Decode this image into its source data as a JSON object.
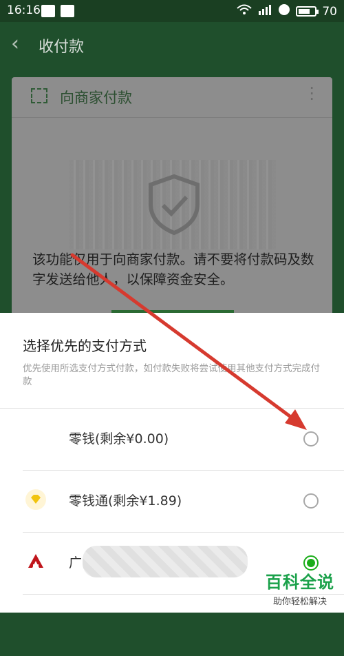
{
  "status": {
    "time": "16:16",
    "battery": "70"
  },
  "header": {
    "title": "收付款"
  },
  "card": {
    "label": "向商家付款",
    "warning": "该功能仅用于向商家付款。请不要将付款码及数字发送给他人，以保障资金安全。"
  },
  "sheet": {
    "title": "选择优先的支付方式",
    "description": "优先使用所选支付方式付款，如付款失败将尝试使用其他支付方式完成付款",
    "options": [
      {
        "label": "零钱(剩余¥0.00)",
        "selected": false
      },
      {
        "label": "零钱通(剩余¥1.89)",
        "selected": false
      },
      {
        "label": "广",
        "selected": true
      }
    ]
  },
  "watermark": {
    "title": "百科全说",
    "subtitle": "助你轻松解决"
  },
  "colors": {
    "accent": "#1aad19",
    "arrow": "#d63a2f",
    "dim_bg": "#1f4f2c"
  }
}
